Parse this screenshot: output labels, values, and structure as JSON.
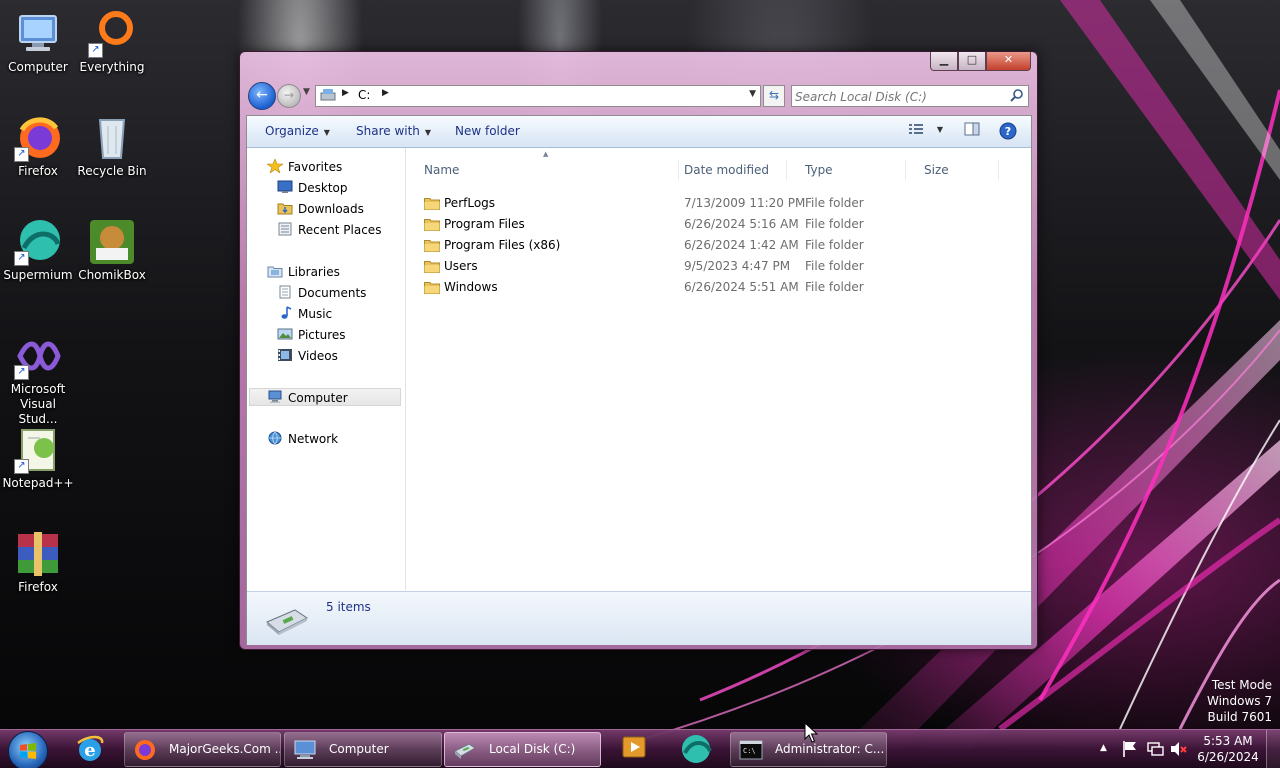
{
  "desktop": {
    "icons": [
      {
        "label": "Computer",
        "icon": "computer-icon"
      },
      {
        "label": "Everything",
        "icon": "everything-icon"
      },
      {
        "label": "Firefox",
        "icon": "firefox-icon"
      },
      {
        "label": "Recycle Bin",
        "icon": "recycle-bin-icon"
      },
      {
        "label": "Supermium",
        "icon": "supermium-icon"
      },
      {
        "label": "ChomikBox",
        "icon": "chomikbox-icon"
      },
      {
        "label": "Microsoft Visual Stud...",
        "icon": "visual-studio-icon"
      },
      {
        "label": "Notepad++",
        "icon": "notepad-plus-plus-icon"
      },
      {
        "label": "Firefox",
        "icon": "winrar-icon"
      }
    ],
    "watermark": [
      "Test Mode",
      "Windows 7",
      "Build 7601"
    ]
  },
  "window": {
    "address": {
      "crumb": "C:"
    },
    "search": {
      "placeholder": "Search Local Disk (C:)"
    },
    "toolbar": {
      "organize": "Organize",
      "share_with": "Share with",
      "new_folder": "New folder"
    },
    "nav_pane": {
      "favorites": "Favorites",
      "desktop": "Desktop",
      "downloads": "Downloads",
      "recent_places": "Recent Places",
      "libraries": "Libraries",
      "documents": "Documents",
      "music": "Music",
      "pictures": "Pictures",
      "videos": "Videos",
      "computer": "Computer",
      "network": "Network"
    },
    "columns": {
      "name": "Name",
      "date_modified": "Date modified",
      "type": "Type",
      "size": "Size"
    },
    "files": [
      {
        "name": "PerfLogs",
        "date": "7/13/2009 11:20 PM",
        "type": "File folder"
      },
      {
        "name": "Program Files",
        "date": "6/26/2024 5:16 AM",
        "type": "File folder"
      },
      {
        "name": "Program Files (x86)",
        "date": "6/26/2024 1:42 AM",
        "type": "File folder"
      },
      {
        "name": "Users",
        "date": "9/5/2023 4:47 PM",
        "type": "File folder"
      },
      {
        "name": "Windows",
        "date": "6/26/2024 5:51 AM",
        "type": "File folder"
      }
    ],
    "details": {
      "item_count": "5 items"
    }
  },
  "taskbar": {
    "buttons": [
      {
        "label": "MajorGeeks.Com ...",
        "icon": "firefox-icon"
      },
      {
        "label": "Computer",
        "icon": "computer-icon"
      },
      {
        "label": "Local Disk (C:)",
        "icon": "explorer-icon"
      },
      {
        "label": "Administrator: C...",
        "icon": "cmd-icon"
      }
    ],
    "clock": {
      "time": "5:53 AM",
      "date": "6/26/2024"
    }
  },
  "colors": {
    "accent_pink": "#ff2fc0",
    "explorer_link_blue": "#1e3287",
    "taskbar_base": "#3c1437"
  }
}
